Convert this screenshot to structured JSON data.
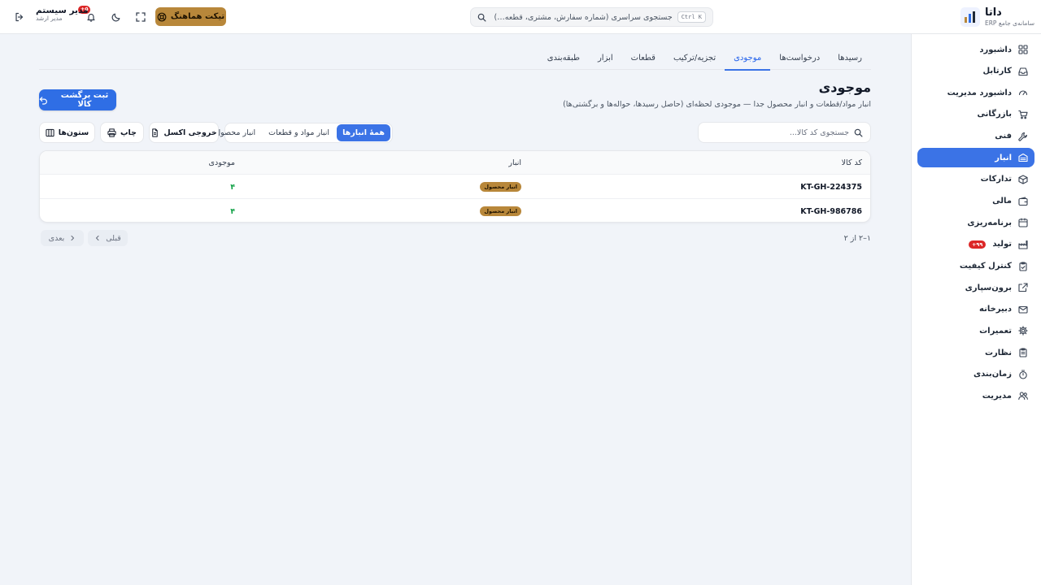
{
  "header": {
    "brand_title": "داتا",
    "brand_subtitle": "سامانه‌ی جامع ERP",
    "search_placeholder": "جستجوی سراسری (شماره سفارش، مشتری، قطعه…)",
    "search_shortcut": "Ctrl K",
    "sync_label": "تیکت هماهنگ",
    "notification_count": "۵+",
    "user_name": "مدیر سیستم",
    "user_role": "مدیر ارشد"
  },
  "sidebar": {
    "active_index": 5,
    "items": [
      {
        "label": "داشبورد",
        "icon": "dashboard-icon"
      },
      {
        "label": "کارتابل",
        "icon": "inbox-icon"
      },
      {
        "label": "داشبورد مدیریت",
        "icon": "gauge-icon"
      },
      {
        "label": "بازرگانی",
        "icon": "cart-icon"
      },
      {
        "label": "فنی",
        "icon": "wrench-icon"
      },
      {
        "label": "انبار",
        "icon": "warehouse-icon"
      },
      {
        "label": "تدارکات",
        "icon": "package-icon"
      },
      {
        "label": "مالی",
        "icon": "wallet-icon"
      },
      {
        "label": "برنامه‌ریزی",
        "icon": "calendar-icon"
      },
      {
        "label": "تولید",
        "icon": "factory-icon",
        "badge": "۹۹+"
      },
      {
        "label": "کنترل کیفیت",
        "icon": "clipboard-check-icon"
      },
      {
        "label": "برون‌سپاری",
        "icon": "external-link-icon"
      },
      {
        "label": "دبیرخانه",
        "icon": "mail-icon"
      },
      {
        "label": "تعمیرات",
        "icon": "gear-icon"
      },
      {
        "label": "نظارت",
        "icon": "clipboard-list-icon"
      },
      {
        "label": "زمان‌بندی",
        "icon": "timer-icon"
      },
      {
        "label": "مدیریت",
        "icon": "users-icon"
      }
    ]
  },
  "tabs": {
    "active_index": 2,
    "items": [
      "رسیدها",
      "درخواست‌ها",
      "موجودی",
      "تجزیه/ترکیب",
      "قطعات",
      "ابزار",
      "طبقه‌بندی"
    ]
  },
  "page": {
    "title": "موجودی",
    "description": "انبار مواد/قطعات و انبار محصول جدا — موجودی لحظه‌ای (حاصل رسیدها، حواله‌ها و برگشتی‌ها)",
    "primary_action": "ثبت برگشت کالا"
  },
  "toolbar": {
    "sku_search_placeholder": "جستجوی کد کالا...",
    "segments": [
      "همهٔ انبارها",
      "انبار مواد و قطعات",
      "انبار محصول"
    ],
    "segment_active": 0,
    "excel_label": "خروجی اکسل",
    "print_label": "چاپ",
    "columns_label": "ستون‌ها"
  },
  "table": {
    "columns": [
      "کد کالا",
      "انبار",
      "موجودی"
    ],
    "rows": [
      {
        "sku": "KT-GH-224375",
        "warehouse": "انبار محصول",
        "qty": "۴"
      },
      {
        "sku": "KT-GH-986786",
        "warehouse": "انبار محصول",
        "qty": "۴"
      }
    ]
  },
  "pagination": {
    "info": "۱–۲ از ۲",
    "prev_label": "قبلی",
    "next_label": "بعدی"
  },
  "colors": {
    "accent": "#3b73e6",
    "badge_gold": "#b8873a",
    "qty_green": "#16a34a",
    "alert_red": "#dc2626"
  }
}
